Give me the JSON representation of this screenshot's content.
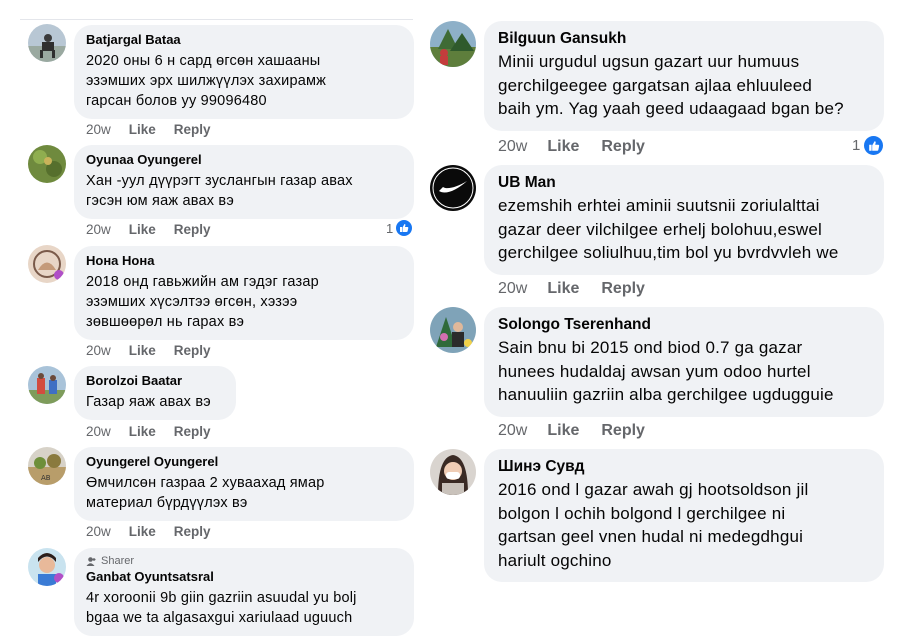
{
  "actions": {
    "like": "Like",
    "reply": "Reply"
  },
  "left": [
    {
      "name": "Batjargal Bataa",
      "text": "2020 оны 6 н сард өгсөн хашааны\nэзэмших эрх шилжүүлэх захирамж\nгарсан болов уу 99096480",
      "time": "20w",
      "reactions": ""
    },
    {
      "name": "Oyunaa Oyungerel",
      "text": "Хан -уул дүүрэгт зуслангын газар авах\nгэсэн юм яаж авах вэ",
      "time": "20w",
      "reactions": "1"
    },
    {
      "name": "Нона Нона",
      "text": "2018 онд гавьжийн ам гэдэг газар\nэзэмших хүсэлтээ өгсөн, хэзээ\nзөвшөөрөл нь гарах вэ",
      "time": "20w",
      "reactions": ""
    },
    {
      "name": "Borolzoi Baatar",
      "text": "Газар яаж авах вэ",
      "time": "20w",
      "reactions": ""
    },
    {
      "name": "Oyungerel Oyungerel",
      "text": "Өмчилсөн газраа 2 хуваахад ямар\nматериал бүрдүүлэх вэ",
      "time": "20w",
      "reactions": ""
    },
    {
      "badge": "Sharer",
      "name": "Ganbat Oyuntsatsral",
      "text": "4r xoroonii 9b giin gazriin asuudal yu bolj\nbgaa we ta algasaxgui xariulaad uguuch",
      "time": "",
      "reactions": ""
    }
  ],
  "right": [
    {
      "name": "Bilguun Gansukh",
      "text": "Minii urgudul ugsun gazart uur humuus\ngerchilgeegee gargatsan ajlaa ehluuleed\nbaih ym. Yag yaah geed udaagaad bgan be?",
      "time": "20w",
      "reactions": "1"
    },
    {
      "name": "UB Man",
      "text": "ezemshih erhtei aminii suutsnii zoriulalttai\ngazar deer vilchilgee erhelj bolohuu,eswel\ngerchilgee soliulhuu,tim bol yu bvrdvvleh we",
      "time": "20w",
      "reactions": ""
    },
    {
      "name": "Solongo Tserenhand",
      "text": "Sain bnu bi 2015 ond biod 0.7 ga gazar\nhunees hudaldaj awsan yum odoo hurtel\nhanuuliin gazriin alba gerchilgee ugdugguie",
      "time": "20w",
      "reactions": ""
    },
    {
      "name": "Шинэ Сувд",
      "text": "2016 ond l gazar awah gj hootsoldson jil\nbolgon l ochih bolgond l gerchilgee ni\ngartsan geel vnen hudal ni medegdhgui\nhariult ogchino",
      "time": "",
      "reactions": ""
    }
  ],
  "colors": {
    "bubble": "#f0f2f5",
    "meta": "#65676b",
    "like_blue": "#1877f2"
  }
}
